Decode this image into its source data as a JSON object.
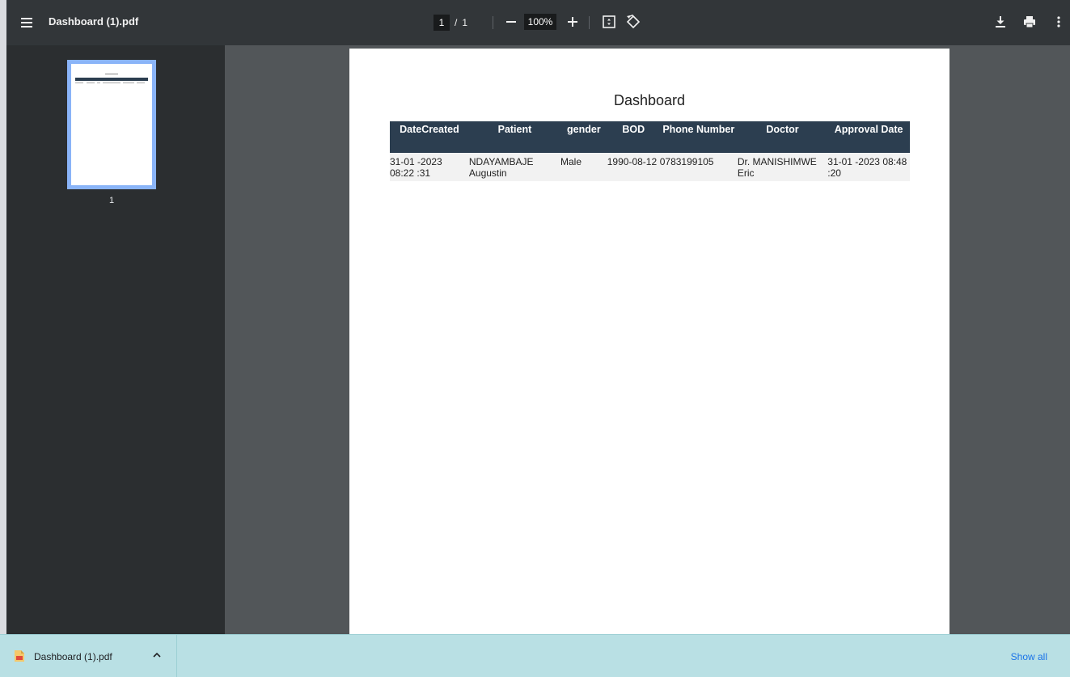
{
  "toolbar": {
    "title": "Dashboard (1).pdf",
    "page_current": "1",
    "page_separator": "/",
    "page_total": "1",
    "zoom": "100%",
    "icons": [
      "menu-icon",
      "zoom-out-icon",
      "zoom-in-icon",
      "fit-to-page-icon",
      "rotate-icon",
      "download-icon",
      "print-icon",
      "more-options-icon"
    ]
  },
  "sidebar": {
    "thumbnails": [
      {
        "label": "1"
      }
    ]
  },
  "document": {
    "title": "Dashboard",
    "table": {
      "headers": [
        "DateCreated",
        "Patient",
        "gender",
        "BOD",
        "Phone Number",
        "Doctor",
        "Approval Date"
      ],
      "rows": [
        [
          "31-01 -2023 08:22 :31",
          "NDAYAMBAJE Augustin",
          "Male",
          "1990-08-12",
          "0783199105",
          "Dr. MANISHIMWE Eric",
          "31-01 -2023 08:48 :20"
        ]
      ],
      "header_color": "#2c3e50"
    }
  },
  "download_bar": {
    "file_name": "Dashboard (1).pdf",
    "show_all": "Show all"
  },
  "colors": {
    "toolbar_bg": "#323639",
    "sidebar_bg": "#2b2e30",
    "viewer_bg": "#525659",
    "thumb_highlight": "#8ab4f8",
    "download_bar_bg": "#b9e0e4",
    "link": "#1a73e8"
  }
}
